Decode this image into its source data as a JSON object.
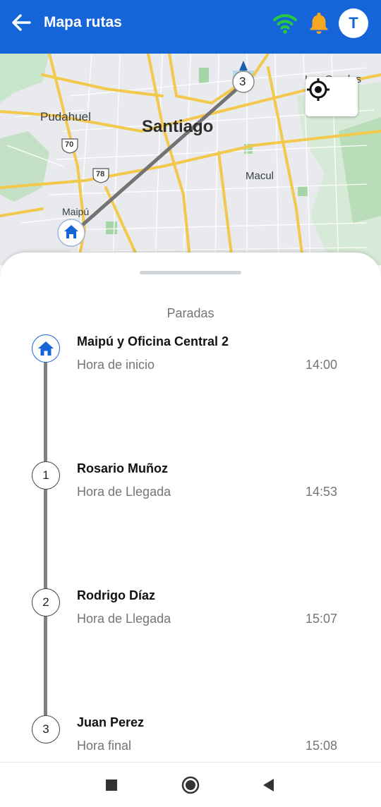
{
  "appbar": {
    "title": "Mapa rutas",
    "avatar_letter": "T",
    "icons": [
      "back-arrow-icon",
      "wifi-icon",
      "bell-icon"
    ],
    "colors": {
      "primary": "#1565d8",
      "wifi": "#27c93f",
      "bell": "#f5a623"
    }
  },
  "map": {
    "labels": {
      "santiago": "Santiago",
      "pudahuel": "Pudahuel",
      "macul": "Macul",
      "maipu": "Maipú",
      "condes": "Las Condes"
    },
    "route_shields": [
      "70",
      "78"
    ],
    "destination_marker": "3"
  },
  "sheet": {
    "title": "Paradas",
    "stops": [
      {
        "marker": "",
        "name": "Maipú y Oficina Central 2",
        "label": "Hora de inicio",
        "time": "14:00"
      },
      {
        "marker": "1",
        "name": "Rosario Muñoz",
        "label": "Hora de Llegada",
        "time": "14:53"
      },
      {
        "marker": "2",
        "name": "Rodrigo Díaz",
        "label": "Hora de Llegada",
        "time": "15:07"
      },
      {
        "marker": "3",
        "name": "Juan Perez",
        "label": "Hora final",
        "time": "15:08"
      }
    ]
  },
  "navbar": {
    "icons": [
      "recents-icon",
      "home-icon",
      "back-icon"
    ]
  }
}
